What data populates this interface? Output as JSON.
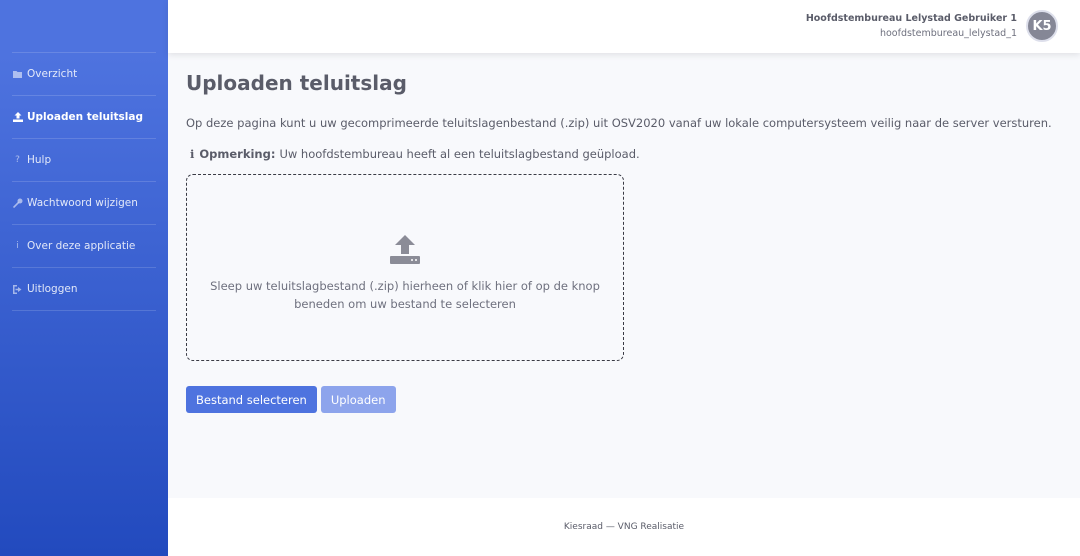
{
  "sidebar": {
    "items": [
      {
        "label": "Overzicht",
        "icon": "folder-icon"
      },
      {
        "label": "Uploaden teluitslag",
        "icon": "upload-icon"
      },
      {
        "label": "Hulp",
        "icon": "question-icon"
      },
      {
        "label": "Wachtwoord wijzigen",
        "icon": "key-icon"
      },
      {
        "label": "Over deze applicatie",
        "icon": "info-icon"
      },
      {
        "label": "Uitloggen",
        "icon": "sign-out-icon"
      }
    ],
    "active_item": "Uploaden teluitslag",
    "gradient_from": "#4e73df",
    "gradient_to": "#224abe"
  },
  "topbar": {
    "user_name": "Hoofdstembureau Lelystad Gebruiker 1",
    "user_login": "hoofdstembureau_lelystad_1",
    "avatar_initials": "K5"
  },
  "main": {
    "title": "Uploaden teluitslag",
    "intro": "Op deze pagina kunt u uw gecomprimeerde teluitslagenbestand (.zip) uit OSV2020 vanaf uw lokale computersysteem veilig naar de server versturen.",
    "note_label": "Opmerking:",
    "note_text": "Uw hoofdstembureau heeft al een teluitslagbestand geüpload.",
    "dropzone_text": "Sleep uw teluitslagbestand (.zip) hierheen of klik hier of op de knop beneden om uw bestand te selecteren",
    "select_button": "Bestand selecteren",
    "upload_button": "Uploaden"
  },
  "footer": {
    "text": "Kiesraad — VNG Realisatie"
  }
}
